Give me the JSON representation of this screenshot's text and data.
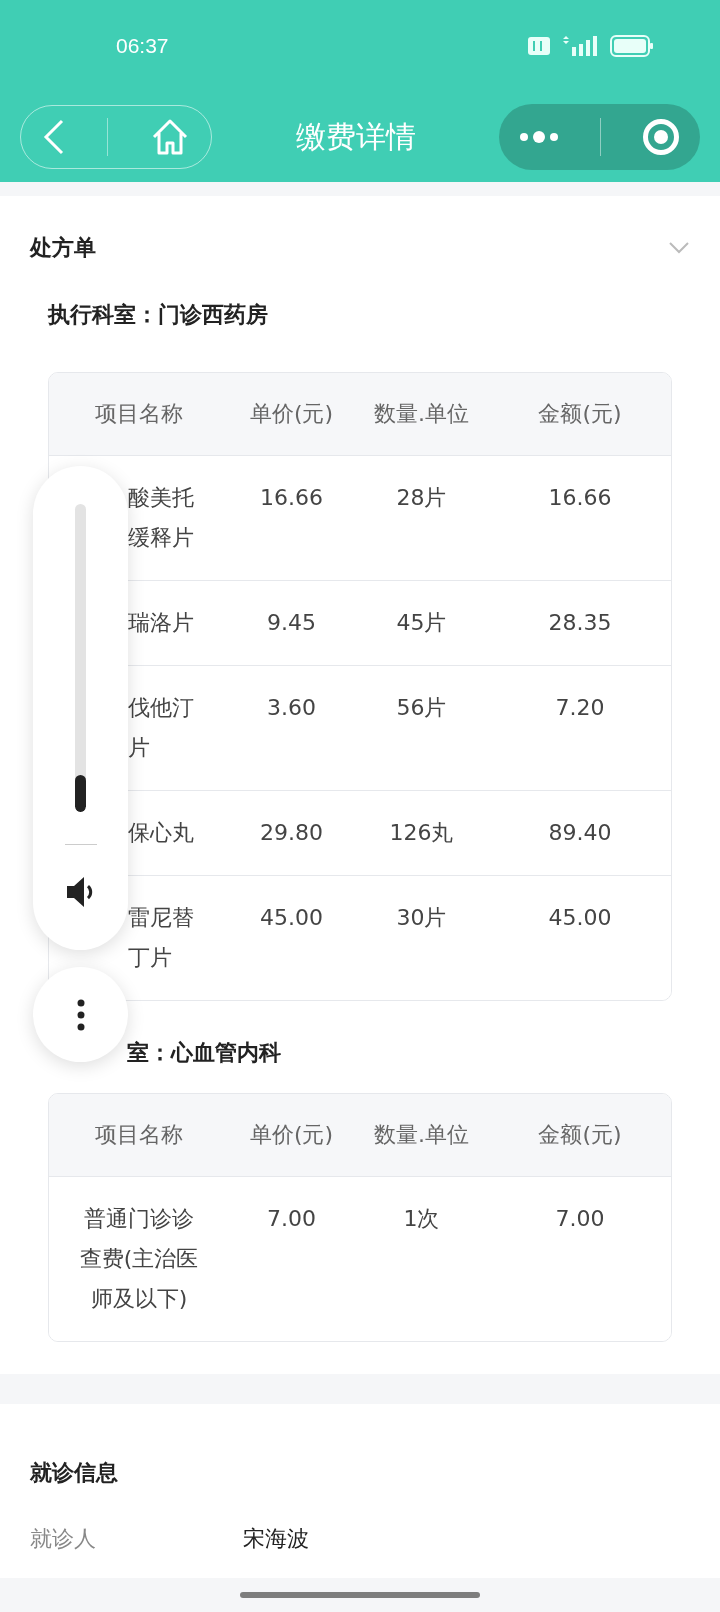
{
  "status_bar": {
    "time": "06:37"
  },
  "nav": {
    "title": "缴费详情"
  },
  "prescription": {
    "title": "处方单",
    "expanded": false,
    "groups": [
      {
        "dept": "执行科室：门诊西药房",
        "columns": [
          "项目名称",
          "单价(元)",
          "数量.单位",
          "金额(元)"
        ],
        "rows": [
          {
            "name": [
              "酸美托",
              "缓释片"
            ],
            "price": "16.66",
            "qty": "28片",
            "amount": "16.66"
          },
          {
            "name": [
              "瑞洛片"
            ],
            "price": "9.45",
            "qty": "45片",
            "amount": "28.35"
          },
          {
            "name": [
              "伐他汀",
              "片"
            ],
            "price": "3.60",
            "qty": "56片",
            "amount": "7.20"
          },
          {
            "name": [
              "保心丸"
            ],
            "price": "29.80",
            "qty": "126丸",
            "amount": "89.40"
          },
          {
            "name": [
              "雷尼替",
              "丁片"
            ],
            "price": "45.00",
            "qty": "30片",
            "amount": "45.00"
          }
        ]
      },
      {
        "dept": "室：心血管内科",
        "columns": [
          "项目名称",
          "单价(元)",
          "数量.单位",
          "金额(元)"
        ],
        "rows": [
          {
            "name": [
              "普通门诊诊",
              "查费(主治医",
              "师及以下)"
            ],
            "price": "7.00",
            "qty": "1次",
            "amount": "7.00"
          }
        ]
      }
    ]
  },
  "visit": {
    "title": "就诊信息",
    "fields": [
      {
        "label": "就诊人",
        "value": "宋海波"
      }
    ]
  },
  "volume": {
    "level": 0.12
  }
}
